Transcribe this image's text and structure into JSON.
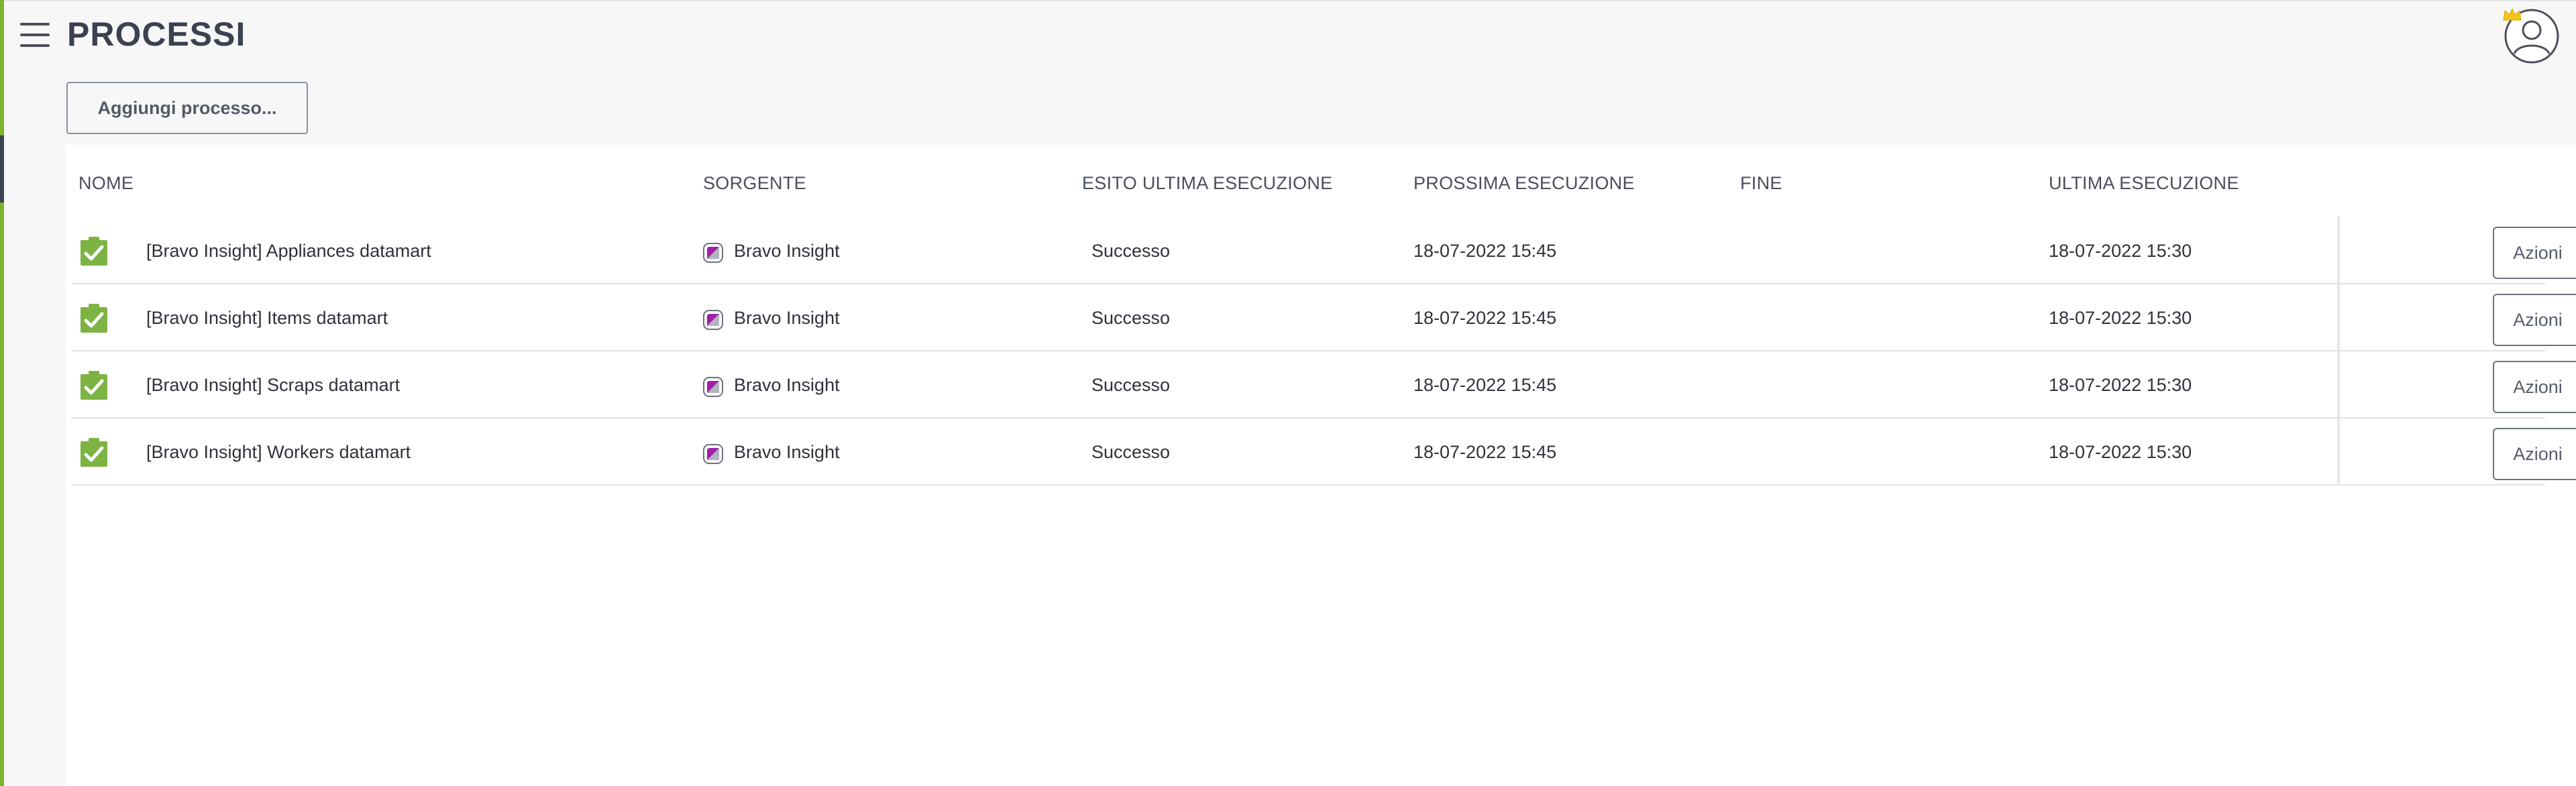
{
  "header": {
    "title": "PROCESSI"
  },
  "toolbar": {
    "add_label": "Aggiungi processo..."
  },
  "table": {
    "columns": [
      "NOME",
      "SORGENTE",
      "ESITO ULTIMA ESECUZIONE",
      "PROSSIMA ESECUZIONE",
      "FINE",
      "ULTIMA ESECUZIONE"
    ],
    "rows": [
      {
        "name": "[Bravo Insight] Appliances datamart",
        "source": "Bravo Insight",
        "outcome": "Successo",
        "next_run": "18-07-2022 15:45",
        "end": "",
        "last_run": "18-07-2022 15:30",
        "actions_label": "Azioni"
      },
      {
        "name": "[Bravo Insight] Items datamart",
        "source": "Bravo Insight",
        "outcome": "Successo",
        "next_run": "18-07-2022 15:45",
        "end": "",
        "last_run": "18-07-2022 15:30",
        "actions_label": "Azioni"
      },
      {
        "name": "[Bravo Insight] Scraps datamart",
        "source": "Bravo Insight",
        "outcome": "Successo",
        "next_run": "18-07-2022 15:45",
        "end": "",
        "last_run": "18-07-2022 15:30",
        "actions_label": "Azioni"
      },
      {
        "name": "[Bravo Insight] Workers datamart",
        "source": "Bravo Insight",
        "outcome": "Successo",
        "next_run": "18-07-2022 15:45",
        "end": "",
        "last_run": "18-07-2022 15:30",
        "actions_label": "Azioni"
      }
    ]
  },
  "icons": {
    "menu": "hamburger-menu-icon",
    "avatar": "user-avatar-icon",
    "crown": "crown-icon",
    "status": "clipboard-check-icon",
    "source": "bravo-insight-logo-icon",
    "chevron": "chevron-down-icon"
  },
  "colors": {
    "accent": "#7db52a",
    "success": "#7cb342",
    "crown": "#f5c518",
    "source_logo": "#9c27b0"
  }
}
